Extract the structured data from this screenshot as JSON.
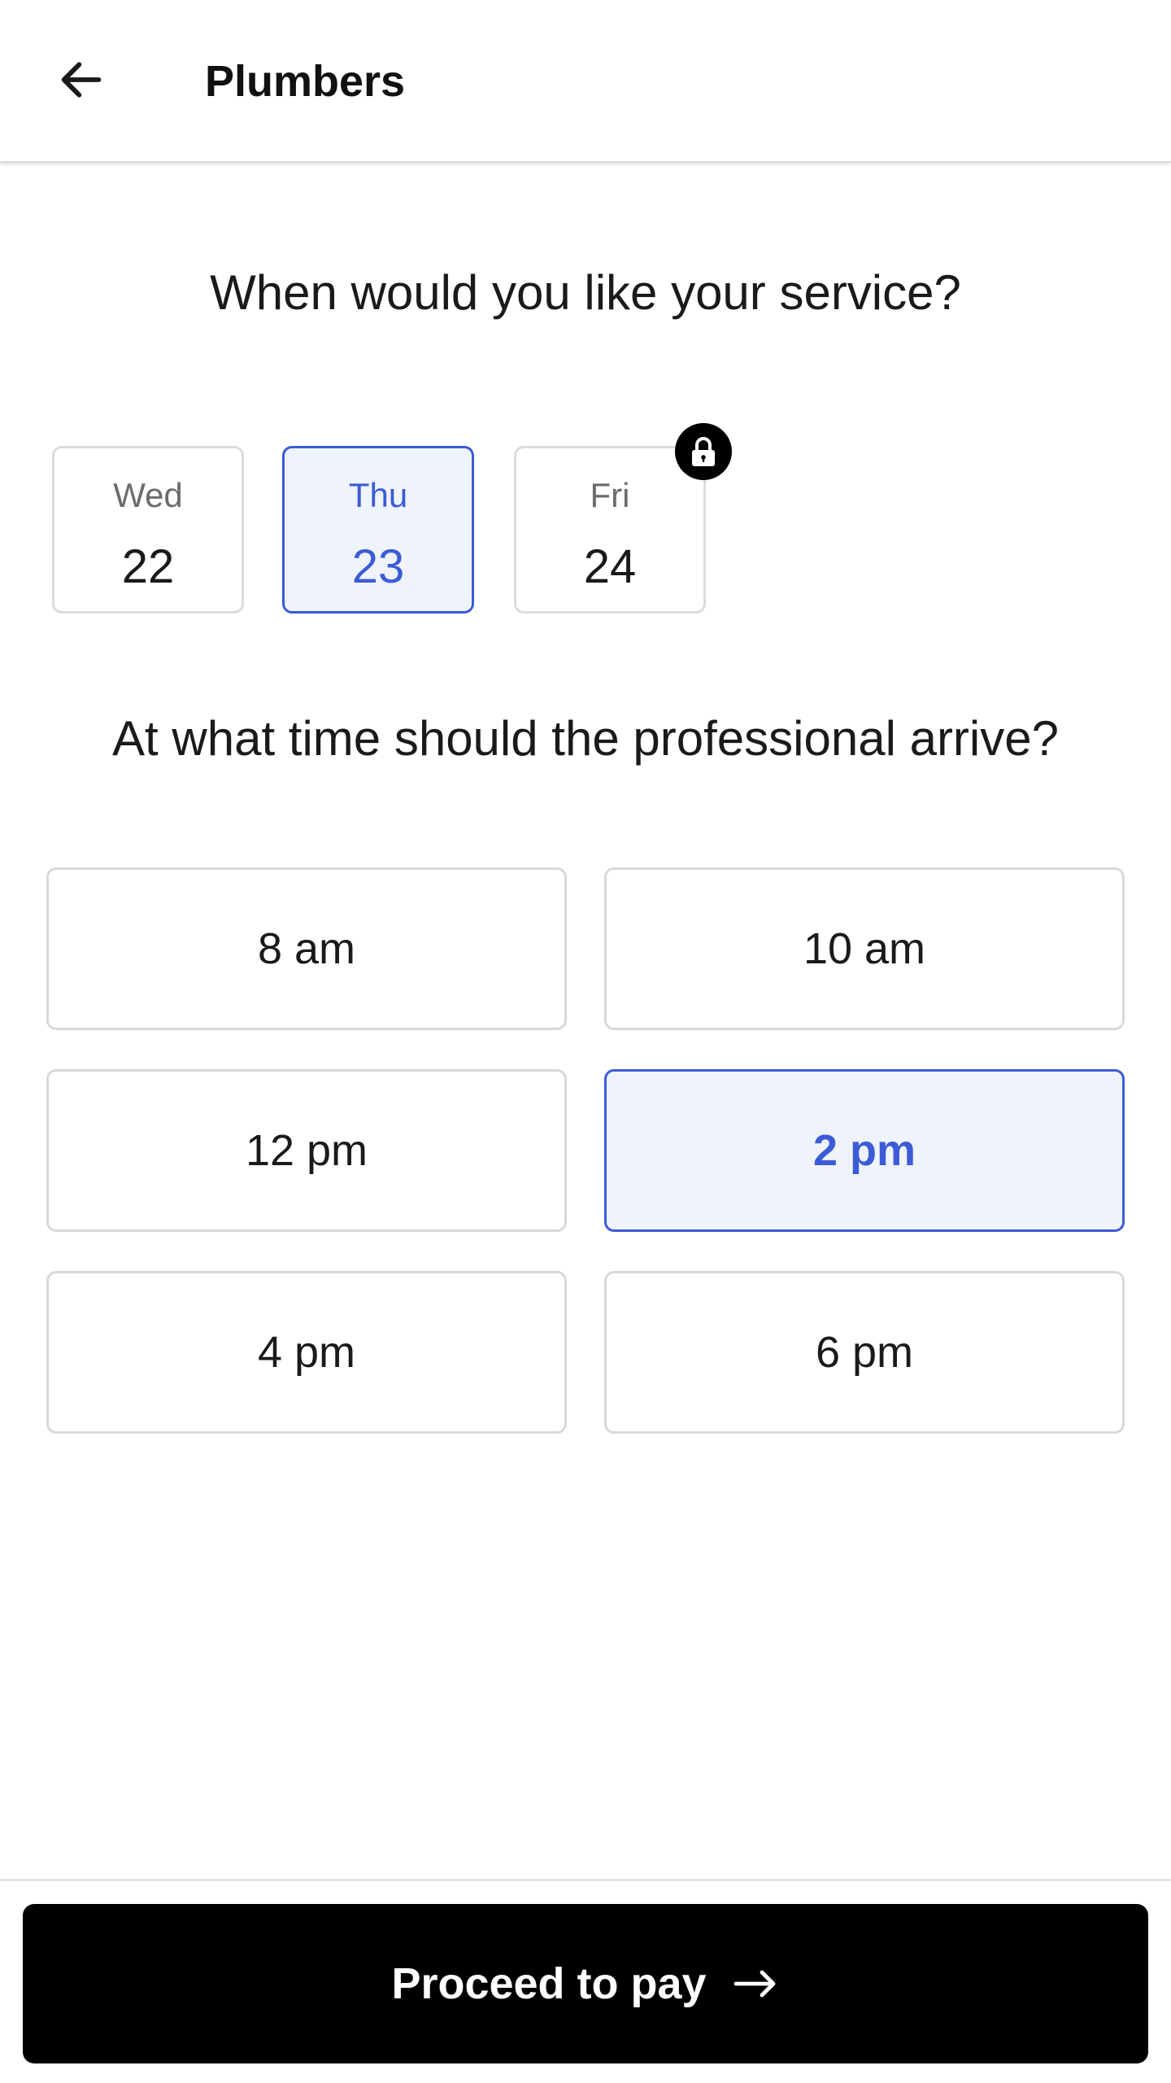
{
  "header": {
    "back_icon": "arrow-left-icon",
    "title": "Plumbers"
  },
  "date_section": {
    "question": "When would you like your service?",
    "dates": [
      {
        "day": "Wed",
        "date": "22",
        "selected": false,
        "locked": false
      },
      {
        "day": "Thu",
        "date": "23",
        "selected": true,
        "locked": false
      },
      {
        "day": "Fri",
        "date": "24",
        "selected": false,
        "locked": true
      }
    ],
    "lock_icon": "lock-icon"
  },
  "time_section": {
    "question": "At what time should the professional arrive?",
    "slots": [
      {
        "label": "8 am",
        "selected": false
      },
      {
        "label": "10 am",
        "selected": false
      },
      {
        "label": "12 pm",
        "selected": false
      },
      {
        "label": "2 pm",
        "selected": true
      },
      {
        "label": "4 pm",
        "selected": false
      },
      {
        "label": "6 pm",
        "selected": false
      }
    ]
  },
  "footer": {
    "proceed_label": "Proceed to pay",
    "proceed_icon": "arrow-right-icon"
  },
  "colors": {
    "accent": "#3c5bd6",
    "selected_bg": "#eff3fc",
    "primary_button_bg": "#000000",
    "border": "#d9d9d9"
  }
}
